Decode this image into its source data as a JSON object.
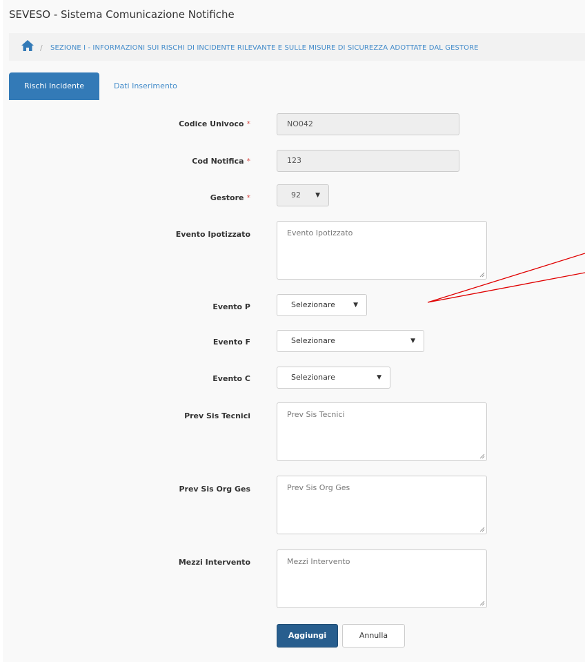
{
  "app": {
    "title": "SEVESO - Sistema Comunicazione Notifiche"
  },
  "breadcrumb": {
    "separator": "/",
    "section": "SEZIONE I - INFORMAZIONI SUI RISCHI DI INCIDENTE RILEVANTE E SULLE MISURE DI SICUREZZA ADOTTATE DAL GESTORE",
    "home_icon": "home-icon"
  },
  "tabs": [
    {
      "label": "Rischi Incidente",
      "active": true
    },
    {
      "label": "Dati Inserimento",
      "active": false
    }
  ],
  "form": {
    "required_marker": "*",
    "codice_univoco": {
      "label": "Codice Univoco",
      "value": "NO042"
    },
    "cod_notifica": {
      "label": "Cod Notifica",
      "value": "123"
    },
    "gestore": {
      "label": "Gestore",
      "value": "92"
    },
    "evento_ipotizzato": {
      "label": "Evento Ipotizzato",
      "placeholder": "Evento Ipotizzato"
    },
    "evento_p": {
      "label": "Evento P",
      "value": "Selezionare"
    },
    "evento_f": {
      "label": "Evento F",
      "value": "Selezionare"
    },
    "evento_c": {
      "label": "Evento C",
      "value": "Selezionare"
    },
    "prev_sis_tecnici": {
      "label": "Prev Sis Tecnici",
      "placeholder": "Prev Sis Tecnici"
    },
    "prev_sis_org_ges": {
      "label": "Prev Sis Org Ges",
      "placeholder": "Prev Sis Org Ges"
    },
    "mezzi_intervento": {
      "label": "Mezzi Intervento",
      "placeholder": "Mezzi Intervento"
    }
  },
  "buttons": {
    "add": "Aggiungi",
    "cancel": "Annulla"
  },
  "colors": {
    "primary": "#337ab7",
    "link": "#428bca",
    "required": "#d9534f",
    "annotation_arrow": "#e00000"
  }
}
